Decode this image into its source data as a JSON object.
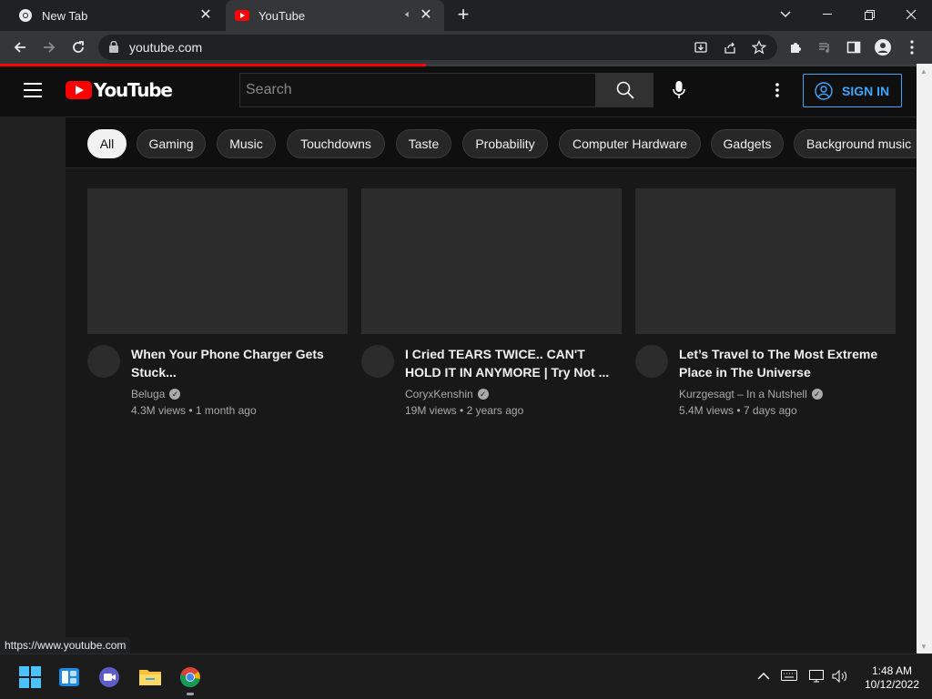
{
  "browser": {
    "tabs": [
      {
        "title": "New Tab",
        "active": false,
        "favicon": "chrome-icon"
      },
      {
        "title": "YouTube",
        "active": true,
        "favicon": "youtube-icon",
        "audio": true
      }
    ],
    "url": "youtube.com",
    "load_progress": 0.465,
    "status_url": "https://www.youtube.com"
  },
  "youtube": {
    "logo_text": "YouTube",
    "search_placeholder": "Search",
    "sign_in_label": "SIGN IN",
    "chips": [
      "All",
      "Gaming",
      "Music",
      "Touchdowns",
      "Taste",
      "Probability",
      "Computer Hardware",
      "Gadgets",
      "Background music"
    ],
    "active_chip": "All",
    "videos": [
      {
        "title": "When Your Phone Charger Gets Stuck...",
        "channel": "Beluga",
        "views": "4.3M views",
        "age": "1 month ago",
        "verified": true
      },
      {
        "title": "I Cried TEARS TWICE.. CAN'T HOLD IT IN ANYMORE | Try Not ...",
        "channel": "CoryxKenshin",
        "views": "19M views",
        "age": "2 years ago",
        "verified": true
      },
      {
        "title": "Let’s Travel to The Most Extreme Place in The Universe",
        "channel": "Kurzgesagt – In a Nutshell",
        "views": "5.4M views",
        "age": "7 days ago",
        "verified": true
      }
    ]
  },
  "taskbar": {
    "time": "1:48 AM",
    "date": "10/12/2022"
  },
  "colors": {
    "brand_red": "#ff0000",
    "link_blue": "#3ea6ff"
  }
}
